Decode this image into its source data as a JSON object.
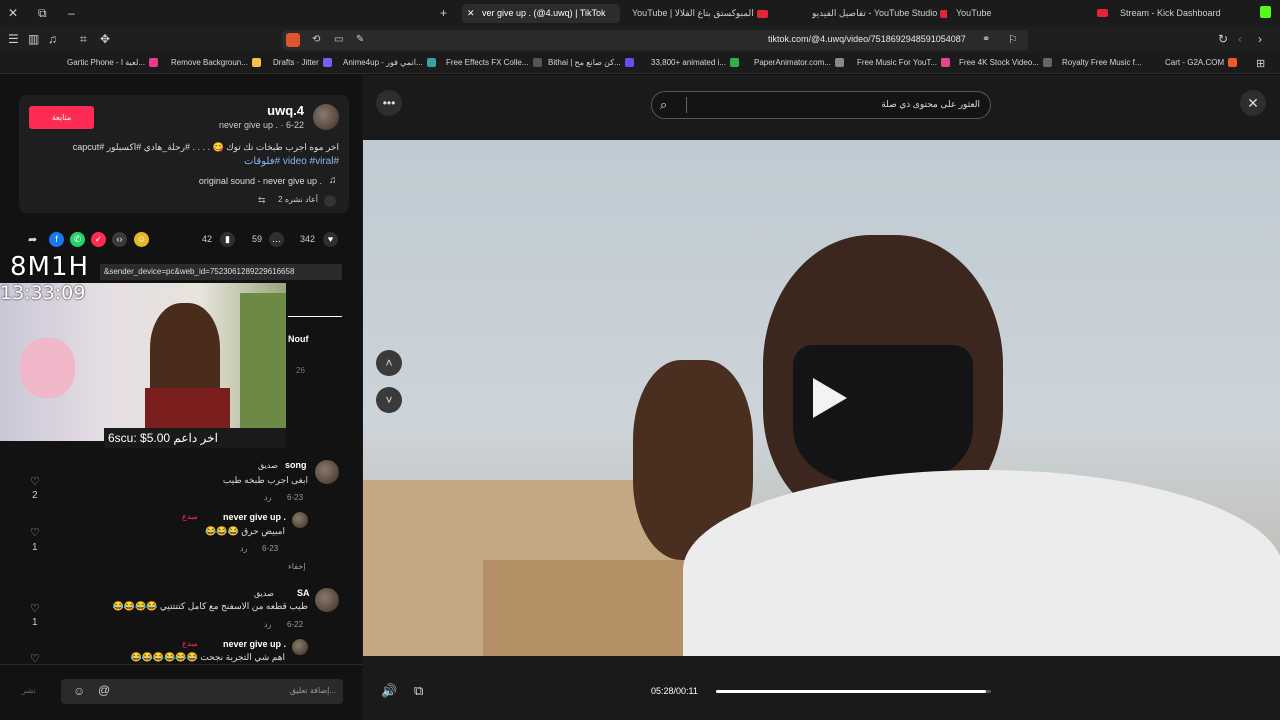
{
  "browser": {
    "tabs": [
      {
        "label": "ver give up ‎. (@4.uwq) | TikTok",
        "active": true
      },
      {
        "label": "YouTube | المبوكستق بتاع القلالا"
      },
      {
        "label": "تفاصيل الفيديو - YouTube Studio"
      },
      {
        "label": "YouTube"
      },
      {
        "label": "Stream - Kick Dashboard"
      }
    ],
    "url": "tiktok.com/@4.uwq/video/7518692948591054087",
    "bookmarks": [
      "Gartic Phone - لعبة ا...",
      "Remove Backgroun...",
      "Drafts · Jitter",
      "Anime4up - انمي فور...",
      "Free Effects FX Colle...",
      "Bithai | كن صانع مح...",
      "33,800+ animated i...",
      "PaperAnimator.com...",
      "Free Music For YouT...",
      "Free 4K Stock Video...",
      "Royalty Free Music f...",
      "Cart - G2A.COM"
    ]
  },
  "post": {
    "follow_label": "متابعة",
    "username": "uwq.4",
    "display_line": "never give up ‎. · 6-22",
    "caption": "اخر موه اجرب طبخات تك توك 😋 . . . . #رحلة_هادي #اكسبلور #capcut",
    "hashtags_line": "#video #viral #فلوقات",
    "sound": "original sound - never give up ‎.",
    "reposts": "2 أعاد نشره",
    "likes": "342",
    "comments": "59",
    "saves": "42"
  },
  "overlay": {
    "timer": "8M1H",
    "clock": "13:33:09",
    "url_hint": "&sender_device=pc&web_id=7523061289229616658",
    "donation": "6scu: $5.00 اخر داعم",
    "side_name": "Nouf",
    "side_count": "26"
  },
  "comments": [
    {
      "author": "song",
      "tag": "صديق",
      "text": "ابغى اجرب طبخه طيب",
      "date": "6-23",
      "reply": "رد",
      "likes": "2"
    },
    {
      "author": "never give up ‎.",
      "tag": "مبدع",
      "text": "امبيض حرق 😂😂😂",
      "date": "6-23",
      "reply": "رد",
      "likes": "1",
      "hide": "إخفاء"
    },
    {
      "author": "SA",
      "tag": "صديق",
      "text": "طيب قطعه من الاسفنج مع كامل كتتتتيي 😂😂😂😂",
      "date": "6-22",
      "reply": "رد",
      "likes": "1"
    },
    {
      "author": "never give up ‎.",
      "tag": "مبدع",
      "text": "اهم شي التجربة نجحت 😂😂😂😂😂😂",
      "likes": ""
    }
  ],
  "comment_input": {
    "placeholder": "إضافة تعليق...",
    "post": "نشر"
  },
  "video": {
    "search_placeholder": "العثور على محتوى ذي صلة",
    "time": "05:28/00:11",
    "progress": 0.98
  },
  "colors": {
    "accent": "#fe2c55",
    "link": "#8ab4f8"
  }
}
